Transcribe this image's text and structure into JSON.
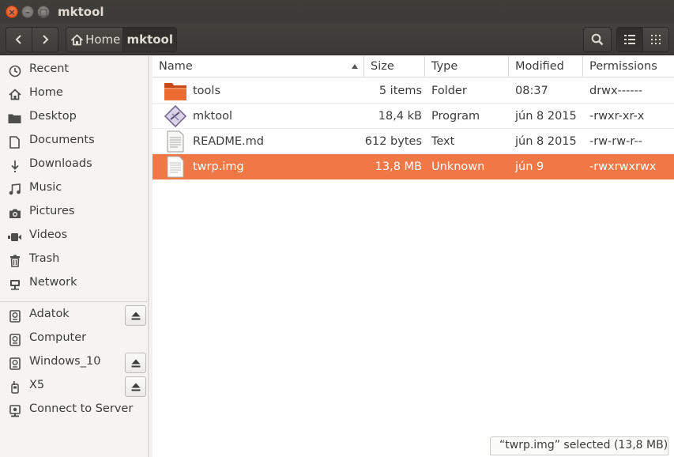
{
  "window": {
    "title": "mktool"
  },
  "toolbar": {
    "breadcrumb": [
      "Home",
      "mktool"
    ]
  },
  "sidebar": {
    "places": [
      {
        "label": "Recent",
        "icon": "clock-icon"
      },
      {
        "label": "Home",
        "icon": "home-icon"
      },
      {
        "label": "Desktop",
        "icon": "folder-icon"
      },
      {
        "label": "Documents",
        "icon": "document-icon"
      },
      {
        "label": "Downloads",
        "icon": "download-icon"
      },
      {
        "label": "Music",
        "icon": "music-icon"
      },
      {
        "label": "Pictures",
        "icon": "camera-icon"
      },
      {
        "label": "Videos",
        "icon": "video-icon"
      },
      {
        "label": "Trash",
        "icon": "trash-icon"
      },
      {
        "label": "Network",
        "icon": "network-icon"
      }
    ],
    "devices": [
      {
        "label": "Adatok",
        "icon": "drive-icon",
        "eject": true
      },
      {
        "label": "Computer",
        "icon": "drive-icon",
        "eject": false
      },
      {
        "label": "Windows_10",
        "icon": "drive-icon",
        "eject": true
      },
      {
        "label": "X5",
        "icon": "phone-icon",
        "eject": true
      },
      {
        "label": "Connect to Server",
        "icon": "server-icon",
        "eject": false
      }
    ]
  },
  "list": {
    "columns": [
      "Name",
      "Size",
      "Type",
      "Modified",
      "Permissions"
    ],
    "sort_column": "Name",
    "rows": [
      {
        "name": "tools",
        "size": "5 items",
        "type": "Folder",
        "modified": "08:37",
        "permissions": "drwx------",
        "icon": "folder-icon"
      },
      {
        "name": "mktool",
        "size": "18,4 kB",
        "type": "Program",
        "modified": "jún 8 2015",
        "permissions": "-rwxr-xr-x",
        "icon": "program-icon"
      },
      {
        "name": "README.md",
        "size": "612 bytes",
        "type": "Text",
        "modified": "jún 8 2015",
        "permissions": "-rw-rw-r--",
        "icon": "text-file-icon"
      },
      {
        "name": "twrp.img",
        "size": "13,8 MB",
        "type": "Unknown",
        "modified": "jún 9",
        "permissions": "-rwxrwxrwx",
        "icon": "file-icon"
      }
    ],
    "selected_index": 3
  },
  "status": {
    "text": "“twrp.img” selected  (13,8 MB)"
  },
  "colors": {
    "selection": "#f07746",
    "titlebar": "#3c3b37",
    "folder": "#e0612b"
  }
}
